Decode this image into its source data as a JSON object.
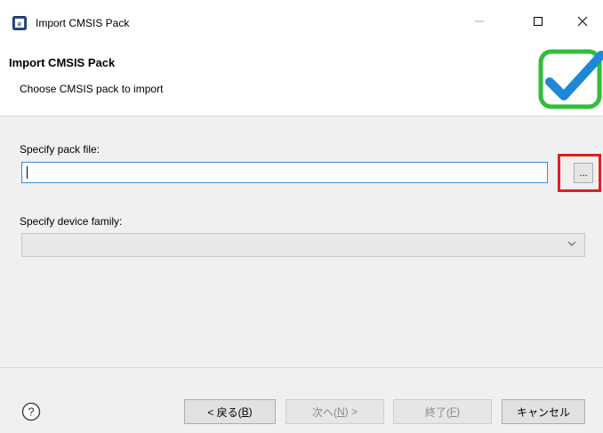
{
  "window": {
    "title": "Import CMSIS Pack",
    "minimize_icon": "minimize-icon",
    "maximize_icon": "maximize-icon",
    "close_icon": "close-icon"
  },
  "header": {
    "title": "Import CMSIS Pack",
    "description": "Choose CMSIS pack to import",
    "logo_icon": "checkmark-logo-icon",
    "colors": {
      "logo_border": "#2fbf3a",
      "logo_check": "#1e88d6"
    }
  },
  "form": {
    "pack_file_label": "Specify pack file:",
    "pack_file_value": "",
    "browse_label": "...",
    "device_family_label": "Specify device family:",
    "device_family_value": ""
  },
  "highlight_color": "#e02020",
  "footer": {
    "help_icon": "help-icon",
    "back": {
      "label": "< 戻る(",
      "mnemonic": "B",
      "suffix": ")"
    },
    "next": {
      "label": "次へ(",
      "mnemonic": "N",
      "suffix": ") >"
    },
    "finish": {
      "label": "終了(",
      "mnemonic": "F",
      "suffix": ")"
    },
    "cancel": {
      "label": "キャンセル"
    }
  }
}
